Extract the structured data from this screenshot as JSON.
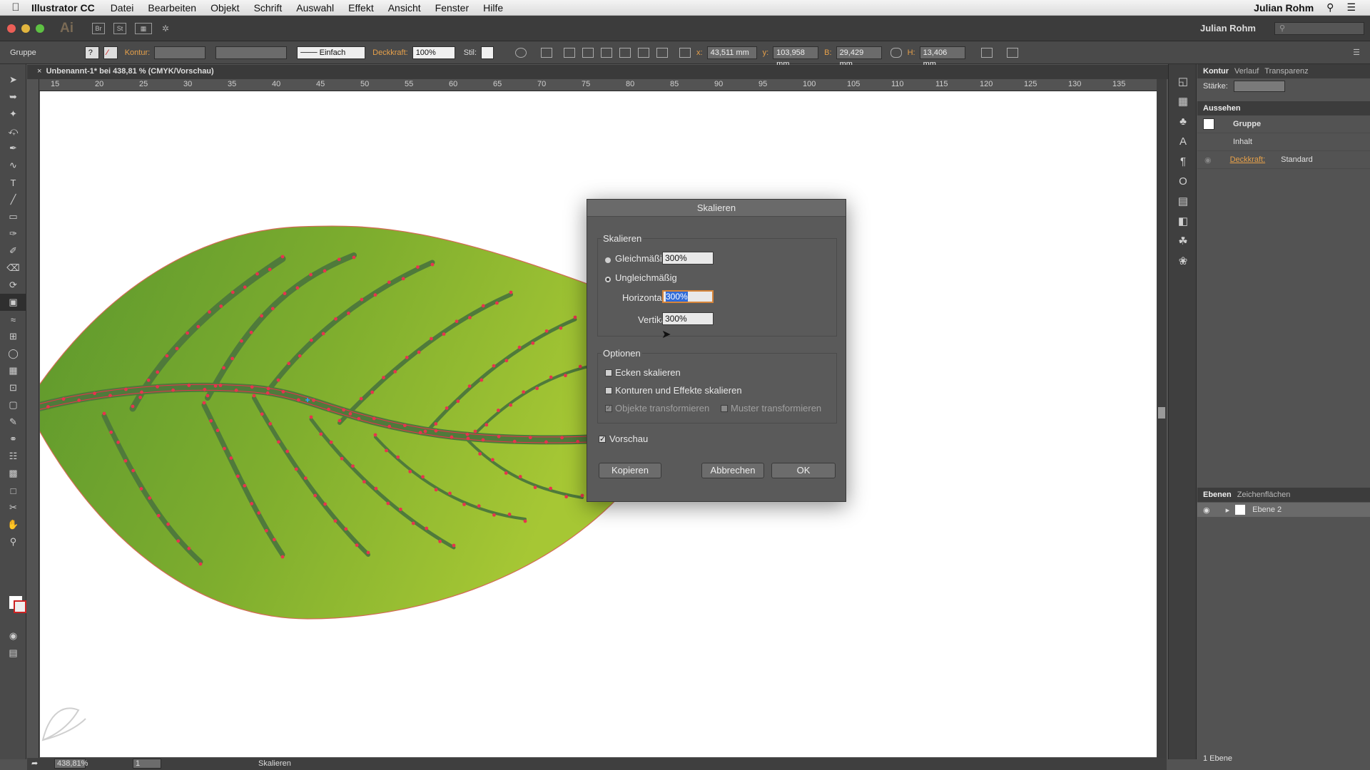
{
  "menubar": {
    "app_name": "Illustrator CC",
    "items": [
      "Datei",
      "Bearbeiten",
      "Objekt",
      "Schrift",
      "Auswahl",
      "Effekt",
      "Ansicht",
      "Fenster",
      "Hilfe"
    ],
    "user": "Julian Rohm"
  },
  "appbar": {
    "logo": "Ai",
    "btn_br": "Br",
    "btn_st": "St",
    "user": "Julian Rohm"
  },
  "controlbar": {
    "selection_label": "Gruppe",
    "kontur_label": "Kontur:",
    "stroke_style": "Einfach",
    "opacity_label": "Deckkraft:",
    "opacity_value": "100%",
    "style_label": "Stil:",
    "x_label": "x:",
    "x_value": "43,511 mm",
    "y_label": "y:",
    "y_value": "103,958 mm",
    "b_label": "B:",
    "b_value": "29,429 mm",
    "h_label": "H:",
    "h_value": "13,406 mm"
  },
  "document": {
    "tab_title": "Unbenannt-1* bei 438,81 % (CMYK/Vorschau)",
    "ruler_h_ticks": [
      "15",
      "20",
      "25",
      "30",
      "35",
      "40",
      "45",
      "50",
      "55",
      "60",
      "65",
      "70",
      "75",
      "80",
      "85",
      "90",
      "95",
      "100",
      "105",
      "110",
      "115",
      "120",
      "125",
      "130",
      "135"
    ]
  },
  "statusbar": {
    "zoom": "438,81%",
    "page": "1",
    "tool": "Skalieren"
  },
  "right_panel": {
    "tabs": [
      "Kontur",
      "Verlauf",
      "Transparenz"
    ],
    "staerke_label": "Stärke:",
    "aussehen_title": "Aussehen",
    "gruppe": "Gruppe",
    "inhalt": "Inhalt",
    "deckkraft_label": "Deckkraft:",
    "deckkraft_value": "Standard",
    "layers_tabs": [
      "Ebenen",
      "Zeichenflächen"
    ],
    "layer_name": "Ebene 2",
    "layer_count": "1 Ebene"
  },
  "dialog": {
    "title": "Skalieren",
    "section_scale": "Skalieren",
    "uniform_label": "Gleichmäßig:",
    "uniform_value": "300%",
    "nonuniform_label": "Ungleichmäßig",
    "horizontal_label": "Horizontal:",
    "horizontal_value": "300%",
    "vertical_label": "Vertikal:",
    "vertical_value": "300%",
    "section_options": "Optionen",
    "opt_corners": "Ecken skalieren",
    "opt_strokes": "Konturen und Effekte skalieren",
    "opt_objects": "Objekte transformieren",
    "opt_pattern": "Muster transformieren",
    "preview_label": "Vorschau",
    "btn_copy": "Kopieren",
    "btn_cancel": "Abbrechen",
    "btn_ok": "OK"
  },
  "colors": {
    "leaf_light": "#9cc132",
    "leaf_dark": "#5f9a2c",
    "vein": "#4f7a3b",
    "anchor": "#e8334d",
    "accent_orange": "#e7a14a"
  }
}
